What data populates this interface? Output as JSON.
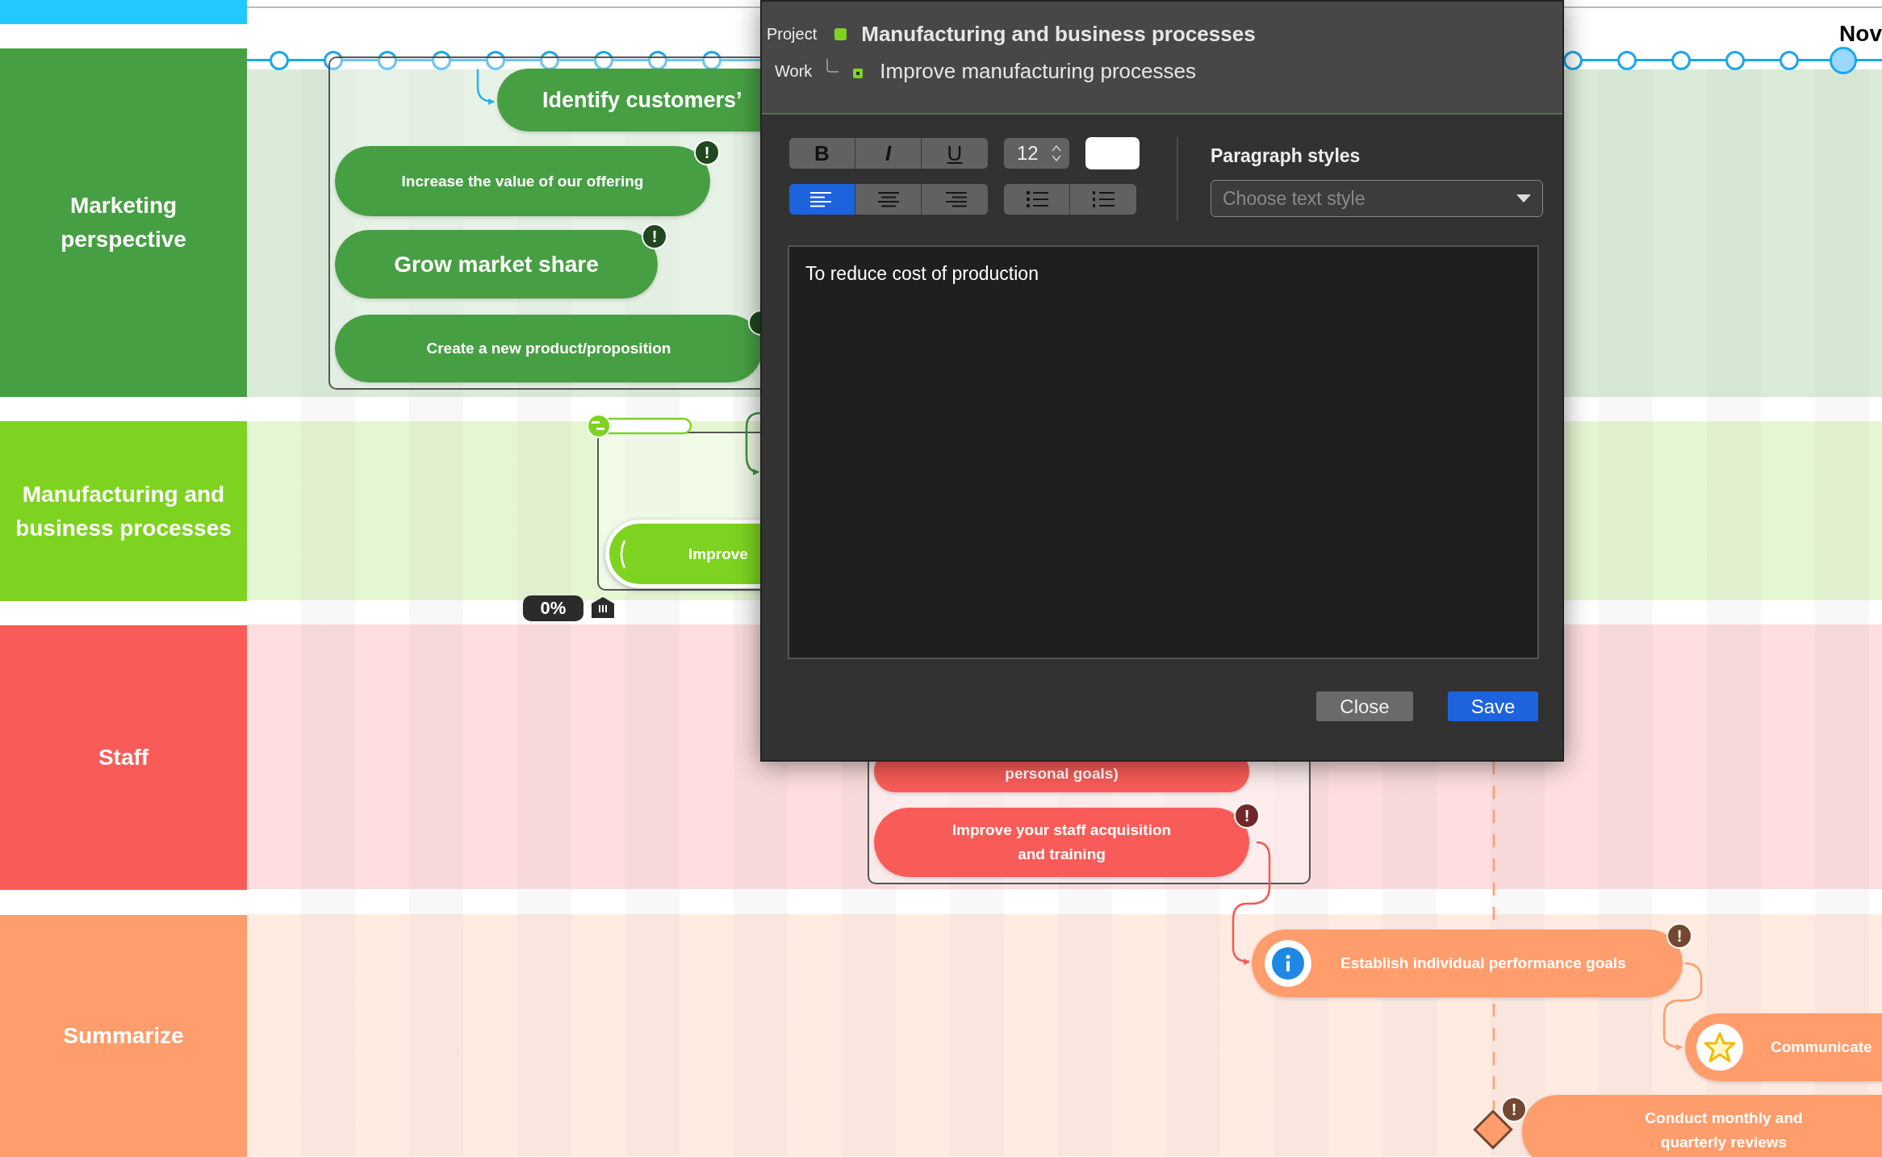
{
  "lanes": [
    {
      "label": "Marketing perspective",
      "color": "#479f43",
      "nodes": [
        {
          "text": "Identify customers’",
          "kind": "plain"
        },
        {
          "text": "Increase the value of our offering",
          "kind": "plain",
          "alert": "!"
        },
        {
          "text": "Grow market share",
          "kind": "plain",
          "alert": "!"
        },
        {
          "text": "Create a new product/proposition",
          "kind": "plain"
        }
      ]
    },
    {
      "label": "Manufacturing and business processes",
      "color": "#7ed321",
      "progress": "0%",
      "nodes": [
        {
          "text": "Improve",
          "kind": "loading"
        }
      ]
    },
    {
      "label": "Staff",
      "color": "#f95c58",
      "nodes": [
        {
          "text": "personal goals)",
          "kind": "plain"
        },
        {
          "text": "Improve your staff acquisition and training",
          "kind": "plain",
          "alert": "!"
        }
      ]
    },
    {
      "label": "Summarize",
      "color": "#ff9d6c",
      "nodes": [
        {
          "text": "Establish individual performance goals",
          "kind": "info",
          "alert": "!"
        },
        {
          "text": "Communicate",
          "kind": "star"
        },
        {
          "text": "Conduct monthly and quarterly reviews",
          "kind": "milestone",
          "alert": "!"
        }
      ]
    }
  ],
  "timeline": {
    "month": "Nov",
    "markers_left": [
      {
        "selected": false
      },
      {
        "selected": false
      },
      {
        "selected": false
      },
      {
        "selected": false
      },
      {
        "selected": false
      },
      {
        "selected": false
      },
      {
        "selected": false
      },
      {
        "selected": false
      },
      {
        "selected": false
      }
    ],
    "markers_right": [
      {
        "selected": false
      },
      {
        "selected": false
      },
      {
        "selected": false
      },
      {
        "selected": false
      },
      {
        "selected": false
      },
      {
        "selected": true
      }
    ]
  },
  "dialog": {
    "project_label": "Project",
    "project": "Manufacturing and business processes",
    "work_label": "Work",
    "work": "Improve manufacturing processes",
    "style_buttons": [
      {
        "label": "B",
        "kind": "bold",
        "selected": false
      },
      {
        "label": "I",
        "kind": "italic",
        "selected": false
      },
      {
        "label": "U",
        "kind": "underline",
        "selected": false
      }
    ],
    "font_size": "12",
    "alignment": [
      {
        "kind": "left",
        "selected": true
      },
      {
        "kind": "center",
        "selected": false
      },
      {
        "kind": "right",
        "selected": false
      }
    ],
    "lists": [
      {
        "kind": "bulleted",
        "selected": false
      },
      {
        "kind": "numbered",
        "selected": false
      }
    ],
    "paragraph_styles": {
      "label": "Paragraph styles",
      "placeholder": "Choose text style"
    },
    "body": "To reduce cost of production",
    "buttons": [
      {
        "label": "Close",
        "kind": "secondary"
      },
      {
        "label": "Save",
        "kind": "primary"
      }
    ]
  }
}
